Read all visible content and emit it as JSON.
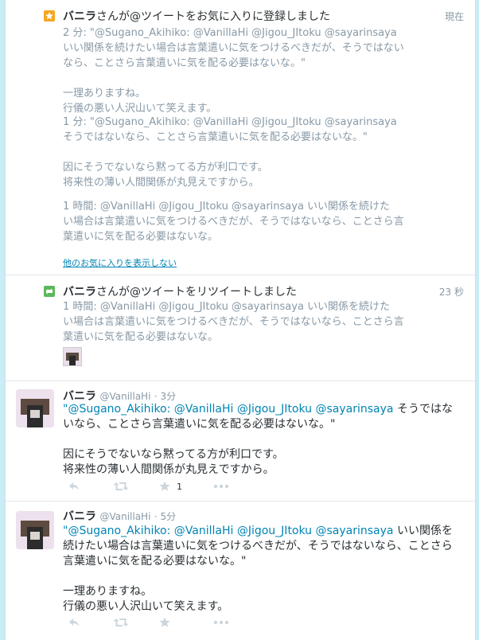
{
  "fav_activity": {
    "actor": "バニラ",
    "action_text": "さんが@ツイートをお気に入りに登録しました",
    "time": "現在",
    "entries": [
      {
        "lead": "2 分: \"@Sugano_Akihiko: @VanillaHi @Jigou_JItoku @sayarinsaya",
        "body": "いい関係を続けたい場合は言葉遣いに気をつけるべきだが、そうではないなら、ことさら言葉遣いに気を配る必要はないな。\"\n\n一理ありますね。\n行儀の悪い人沢山いて笑えます。"
      },
      {
        "lead": "1 分: \"@Sugano_Akihiko: @VanillaHi @Jigou_JItoku @sayarinsaya",
        "body": "そうではないなら、ことさら言葉遣いに気を配る必要はないな。\"\n\n因にそうでないなら黙ってる方が利口です。\n将来性の薄い人間関係が丸見えですから。"
      },
      {
        "lead": "1 時間: @VanillaHi @Jigou_JItoku @sayarinsaya いい関係を続けた",
        "body": "い場合は言葉遣いに気をつけるべきだが、そうではないなら、ことさら言葉遣いに気を配る必要はないな。"
      }
    ],
    "show_less_link": "他のお気に入りを表示しない"
  },
  "rt_activity": {
    "actor": "バニラ",
    "action_text": "さんが@ツイートをリツイートしました",
    "time": "23 秒",
    "lead": "1 時間: @VanillaHi @Jigou_JItoku @sayarinsaya いい関係を続けた",
    "body": "い場合は言葉遣いに気をつけるべきだが、そうではないなら、ことさら言葉遣いに気を配る必要はないな。"
  },
  "tweets": [
    {
      "name": "バニラ",
      "handle": "@VanillaHi",
      "time": "· 3分",
      "mentions": "\"@Sugano_Akihiko: @VanillaHi @Jigou_JItoku @sayarinsaya",
      "text": " そうではないなら、ことさら言葉遣いに気を配る必要はないな。\"\n\n因にそうでないなら黙ってる方が利口です。\n将来性の薄い人間関係が丸見えですから。",
      "fav_count": "1"
    },
    {
      "name": "バニラ",
      "handle": "@VanillaHi",
      "time": "· 5分",
      "mentions": "\"@Sugano_Akihiko: @VanillaHi @Jigou_JItoku @sayarinsaya",
      "text": " いい関係を続けたい場合は言葉遣いに気をつけるべきだが、そうではないなら、ことさら言葉遣いに気を配る必要はないな。\"\n\n一理ありますね。\n行儀の悪い人沢山いて笑えます。",
      "fav_count": ""
    }
  ],
  "icons": {
    "favorite_activity": "star-icon",
    "retweet_activity": "retweet-icon",
    "reply": "reply-icon",
    "retweet": "retweet-icon",
    "favorite": "star-icon",
    "more": "more-icon"
  },
  "colors": {
    "link": "#0084b4",
    "muted": "#8899a6",
    "star": "#f5a623",
    "retweet": "#5cb85c"
  }
}
